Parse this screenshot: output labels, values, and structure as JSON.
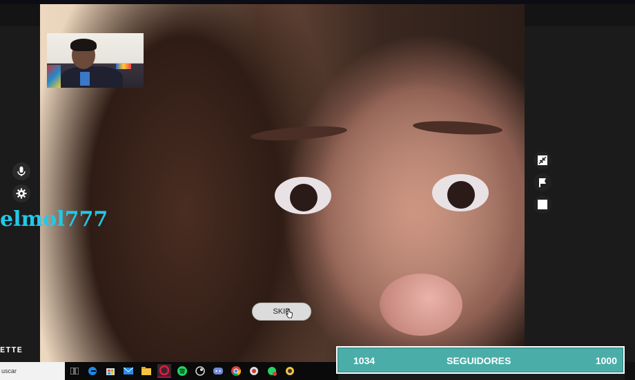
{
  "call": {
    "username_overlay": "elmol777",
    "skip_label": "SKIP"
  },
  "brand": {
    "text": "ETTE"
  },
  "sidebar_left": {
    "icons": [
      "microphone-icon",
      "settings-gear-icon"
    ]
  },
  "sidebar_right": {
    "icons": [
      "exit-fullscreen-icon",
      "report-flag-icon",
      "stop-icon"
    ]
  },
  "taskbar": {
    "search_placeholder": "uscar",
    "apps": [
      "task-view-icon",
      "edge-icon",
      "store-icon",
      "mail-icon",
      "file-explorer-icon",
      "opera-icon",
      "spotify-icon",
      "steam-icon",
      "discord-icon",
      "chrome-icon",
      "app-icon",
      "whatsapp-icon",
      "app-icon-2"
    ]
  },
  "follower_goal": {
    "current": "1034",
    "label": "SEGUIDORES",
    "target": "1000",
    "bar_color": "#4aada8"
  }
}
